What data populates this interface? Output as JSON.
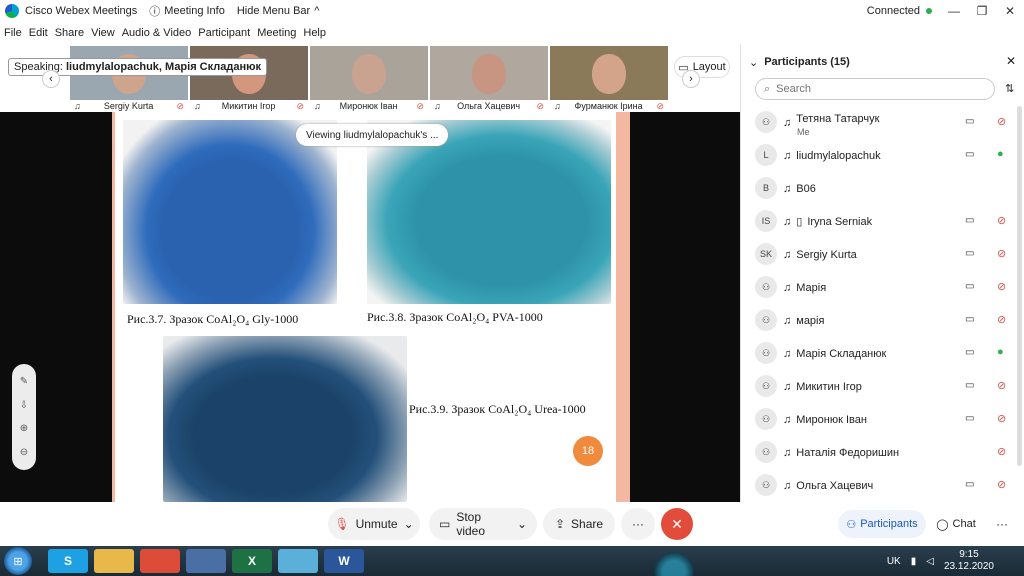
{
  "window": {
    "app_title": "Cisco Webex Meetings",
    "meeting_info": "Meeting Info",
    "hide_menu": "Hide Menu Bar",
    "hide_menu_chevron": "^",
    "connection": "Connected",
    "controls": {
      "minimize": "—",
      "restore": "❐",
      "close": "✕"
    }
  },
  "menu": [
    "File",
    "Edit",
    "Share",
    "View",
    "Audio & Video",
    "Participant",
    "Meeting",
    "Help"
  ],
  "speaking": {
    "label": "Speaking:",
    "names": "liudmylalopachuk, Марія Складанюк"
  },
  "video_strip": {
    "thumbnails": [
      {
        "name": "Sergiy Kurta",
        "face_color": "#cfa48c",
        "bg_color": "#9aa6b0"
      },
      {
        "name": "Микитин Ігор",
        "face_color": "#d2977c",
        "bg_color": "#7a6a5c"
      },
      {
        "name": "Миронюк Іван",
        "face_color": "#c9a38f",
        "bg_color": "#a9a39a"
      },
      {
        "name": "Ольга Хацевич",
        "face_color": "#c79582",
        "bg_color": "#b0a79e"
      },
      {
        "name": "Фурманюк Ірина",
        "face_color": "#d4a48a",
        "bg_color": "#8a7a5a"
      }
    ],
    "layout_label": "Layout",
    "nav_prev": "‹",
    "nav_next": "›"
  },
  "share": {
    "viewing_text": "Viewing liudmylalopachuk's ...",
    "captions": {
      "c1": "Рис.3.7. Зразок CoAl₂O₄ Gly-1000",
      "c2": "Рис.3.8. Зразок CoAl₂O₄ PVA-1000",
      "c3": "Рис.3.9. Зразок CoAl₂O₄ Urea-1000"
    },
    "page_number": "18",
    "zoom_tools": [
      "✎",
      "⇩",
      "⊕",
      "⊖"
    ]
  },
  "controls": {
    "unmute": "Unmute",
    "stop_video": "Stop video",
    "share": "Share",
    "more": "···",
    "end": "✕",
    "caret": "⌄"
  },
  "panel": {
    "title": "Participants (15)",
    "chevron": "⌄",
    "close": "✕",
    "search_placeholder": "Search",
    "sort_icon": "⇅",
    "participants": [
      {
        "initials": "",
        "name": "Тетяна Татарчук",
        "sub": "Me",
        "phone": "",
        "camera": true,
        "mic": "muted"
      },
      {
        "initials": "L",
        "name": "liudmylalopachuk",
        "sub": "",
        "phone": "",
        "camera": true,
        "mic": "on"
      },
      {
        "initials": "B",
        "name": "B06",
        "sub": "",
        "phone": "",
        "camera": false,
        "mic": "none"
      },
      {
        "initials": "IS",
        "name": "Iryna Serniak",
        "sub": "",
        "phone": "▯",
        "camera": true,
        "mic": "muted"
      },
      {
        "initials": "SK",
        "name": "Sergiy Kurta",
        "sub": "",
        "phone": "",
        "camera": true,
        "mic": "muted"
      },
      {
        "initials": "",
        "name": "Марія",
        "sub": "",
        "phone": "",
        "camera": true,
        "mic": "muted"
      },
      {
        "initials": "",
        "name": "марія",
        "sub": "",
        "phone": "",
        "camera": true,
        "mic": "muted"
      },
      {
        "initials": "",
        "name": "Марія Складанюк",
        "sub": "",
        "phone": "",
        "camera": true,
        "mic": "on"
      },
      {
        "initials": "",
        "name": "Микитин Ігор",
        "sub": "",
        "phone": "",
        "camera": true,
        "mic": "muted"
      },
      {
        "initials": "",
        "name": "Миронюк Іван",
        "sub": "",
        "phone": "",
        "camera": true,
        "mic": "muted"
      },
      {
        "initials": "",
        "name": "Наталія Федоришин",
        "sub": "",
        "phone": "",
        "camera": false,
        "mic": "muted"
      },
      {
        "initials": "",
        "name": "Ольга Хацевич",
        "sub": "",
        "phone": "",
        "camera": true,
        "mic": "muted"
      }
    ]
  },
  "tabs": {
    "participants": "Participants",
    "chat": "Chat",
    "more": "···"
  },
  "taskbar": {
    "apps": [
      "S",
      "",
      "",
      "",
      "X",
      "",
      "W"
    ],
    "language": "UK",
    "time": "9:15",
    "date": "23.12.2020"
  },
  "colors": {
    "muted": "#d9534f",
    "active_mic": "#2eae4e",
    "end_call": "#e24c3b",
    "page_badge": "#f08a3c"
  }
}
